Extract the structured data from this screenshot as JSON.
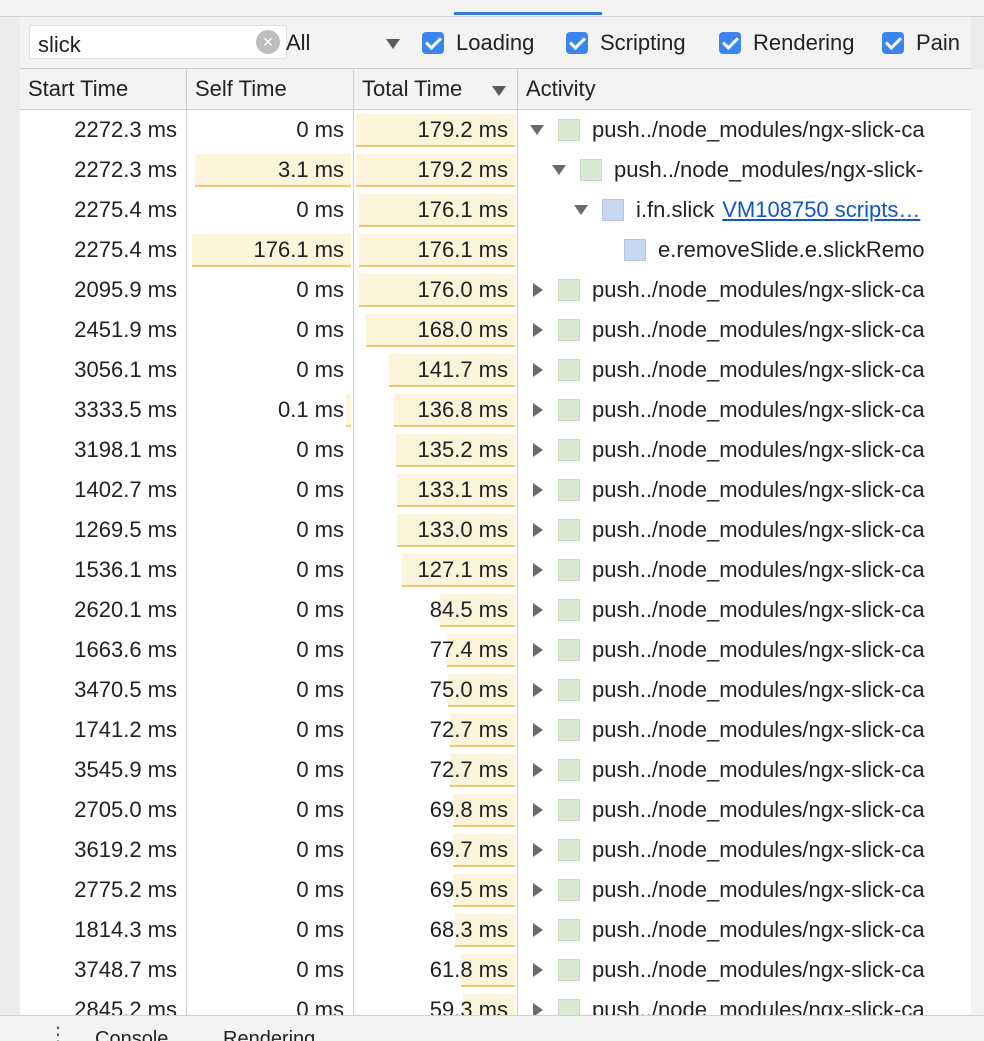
{
  "toolbar": {
    "search_value": "slick",
    "level_value": "All",
    "filters": [
      {
        "label": "Loading",
        "checked": true
      },
      {
        "label": "Scripting",
        "checked": true
      },
      {
        "label": "Rendering",
        "checked": true
      },
      {
        "label": "Pain",
        "checked": true
      }
    ]
  },
  "table": {
    "columns": {
      "start": "Start Time",
      "self": "Self Time",
      "total": "Total Time",
      "activity": "Activity"
    },
    "rows": [
      {
        "start": "2272.3 ms",
        "self": "0 ms",
        "total": "179.2 ms",
        "self_frac": 0,
        "total_frac": 1.0,
        "depth": 0,
        "expander": "down",
        "swatch": "green",
        "activity": "push../node_modules/ngx-slick-ca",
        "link": ""
      },
      {
        "start": "2272.3 ms",
        "self": "3.1 ms",
        "total": "179.2 ms",
        "self_frac": 0.96,
        "total_frac": 1.0,
        "depth": 1,
        "expander": "down",
        "swatch": "green",
        "activity": "push../node_modules/ngx-slick-",
        "link": ""
      },
      {
        "start": "2275.4 ms",
        "self": "0 ms",
        "total": "176.1 ms",
        "self_frac": 0,
        "total_frac": 0.98,
        "depth": 2,
        "expander": "down",
        "swatch": "blue",
        "activity": "i.fn.slick",
        "link": "VM108750 scripts…"
      },
      {
        "start": "2275.4 ms",
        "self": "176.1 ms",
        "total": "176.1 ms",
        "self_frac": 0.98,
        "total_frac": 0.98,
        "depth": 3,
        "expander": "none",
        "swatch": "blue",
        "activity": "e.removeSlide.e.slickRemo",
        "link": ""
      },
      {
        "start": "2095.9 ms",
        "self": "0 ms",
        "total": "176.0 ms",
        "self_frac": 0,
        "total_frac": 0.98,
        "depth": 0,
        "expander": "right",
        "swatch": "green",
        "activity": "push../node_modules/ngx-slick-ca",
        "link": ""
      },
      {
        "start": "2451.9 ms",
        "self": "0 ms",
        "total": "168.0 ms",
        "self_frac": 0,
        "total_frac": 0.94,
        "depth": 0,
        "expander": "right",
        "swatch": "green",
        "activity": "push../node_modules/ngx-slick-ca",
        "link": ""
      },
      {
        "start": "3056.1 ms",
        "self": "0 ms",
        "total": "141.7 ms",
        "self_frac": 0,
        "total_frac": 0.79,
        "depth": 0,
        "expander": "right",
        "swatch": "green",
        "activity": "push../node_modules/ngx-slick-ca",
        "link": ""
      },
      {
        "start": "3333.5 ms",
        "self": "0.1 ms",
        "total": "136.8 ms",
        "self_frac": 0.03,
        "total_frac": 0.76,
        "depth": 0,
        "expander": "right",
        "swatch": "green",
        "activity": "push../node_modules/ngx-slick-ca",
        "link": ""
      },
      {
        "start": "3198.1 ms",
        "self": "0 ms",
        "total": "135.2 ms",
        "self_frac": 0,
        "total_frac": 0.75,
        "depth": 0,
        "expander": "right",
        "swatch": "green",
        "activity": "push../node_modules/ngx-slick-ca",
        "link": ""
      },
      {
        "start": "1402.7 ms",
        "self": "0 ms",
        "total": "133.1 ms",
        "self_frac": 0,
        "total_frac": 0.74,
        "depth": 0,
        "expander": "right",
        "swatch": "green",
        "activity": "push../node_modules/ngx-slick-ca",
        "link": ""
      },
      {
        "start": "1269.5 ms",
        "self": "0 ms",
        "total": "133.0 ms",
        "self_frac": 0,
        "total_frac": 0.74,
        "depth": 0,
        "expander": "right",
        "swatch": "green",
        "activity": "push../node_modules/ngx-slick-ca",
        "link": ""
      },
      {
        "start": "1536.1 ms",
        "self": "0 ms",
        "total": "127.1 ms",
        "self_frac": 0,
        "total_frac": 0.71,
        "depth": 0,
        "expander": "right",
        "swatch": "green",
        "activity": "push../node_modules/ngx-slick-ca",
        "link": ""
      },
      {
        "start": "2620.1 ms",
        "self": "0 ms",
        "total": "84.5 ms",
        "self_frac": 0,
        "total_frac": 0.47,
        "depth": 0,
        "expander": "right",
        "swatch": "green",
        "activity": "push../node_modules/ngx-slick-ca",
        "link": ""
      },
      {
        "start": "1663.6 ms",
        "self": "0 ms",
        "total": "77.4 ms",
        "self_frac": 0,
        "total_frac": 0.43,
        "depth": 0,
        "expander": "right",
        "swatch": "green",
        "activity": "push../node_modules/ngx-slick-ca",
        "link": ""
      },
      {
        "start": "3470.5 ms",
        "self": "0 ms",
        "total": "75.0 ms",
        "self_frac": 0,
        "total_frac": 0.42,
        "depth": 0,
        "expander": "right",
        "swatch": "green",
        "activity": "push../node_modules/ngx-slick-ca",
        "link": ""
      },
      {
        "start": "1741.2 ms",
        "self": "0 ms",
        "total": "72.7 ms",
        "self_frac": 0,
        "total_frac": 0.41,
        "depth": 0,
        "expander": "right",
        "swatch": "green",
        "activity": "push../node_modules/ngx-slick-ca",
        "link": ""
      },
      {
        "start": "3545.9 ms",
        "self": "0 ms",
        "total": "72.7 ms",
        "self_frac": 0,
        "total_frac": 0.41,
        "depth": 0,
        "expander": "right",
        "swatch": "green",
        "activity": "push../node_modules/ngx-slick-ca",
        "link": ""
      },
      {
        "start": "2705.0 ms",
        "self": "0 ms",
        "total": "69.8 ms",
        "self_frac": 0,
        "total_frac": 0.39,
        "depth": 0,
        "expander": "right",
        "swatch": "green",
        "activity": "push../node_modules/ngx-slick-ca",
        "link": ""
      },
      {
        "start": "3619.2 ms",
        "self": "0 ms",
        "total": "69.7 ms",
        "self_frac": 0,
        "total_frac": 0.39,
        "depth": 0,
        "expander": "right",
        "swatch": "green",
        "activity": "push../node_modules/ngx-slick-ca",
        "link": ""
      },
      {
        "start": "2775.2 ms",
        "self": "0 ms",
        "total": "69.5 ms",
        "self_frac": 0,
        "total_frac": 0.39,
        "depth": 0,
        "expander": "right",
        "swatch": "green",
        "activity": "push../node_modules/ngx-slick-ca",
        "link": ""
      },
      {
        "start": "1814.3 ms",
        "self": "0 ms",
        "total": "68.3 ms",
        "self_frac": 0,
        "total_frac": 0.38,
        "depth": 0,
        "expander": "right",
        "swatch": "green",
        "activity": "push../node_modules/ngx-slick-ca",
        "link": ""
      },
      {
        "start": "3748.7 ms",
        "self": "0 ms",
        "total": "61.8 ms",
        "self_frac": 0,
        "total_frac": 0.34,
        "depth": 0,
        "expander": "right",
        "swatch": "green",
        "activity": "push../node_modules/ngx-slick-ca",
        "link": ""
      },
      {
        "start": "2845.2 ms",
        "self": "0 ms",
        "total": "59.3 ms",
        "self_frac": 0,
        "total_frac": 0.33,
        "depth": 0,
        "expander": "right",
        "swatch": "green",
        "activity": "push../node_modules/ngx-slick-ca",
        "link": ""
      }
    ]
  },
  "bottom": {
    "tabs": [
      "Console",
      "Rendering"
    ]
  },
  "colors": {
    "bar_fill": "#fdf4dc",
    "bar_edge": "#f3c878",
    "checkbox": "#3b85f0",
    "link": "#1155cc"
  }
}
